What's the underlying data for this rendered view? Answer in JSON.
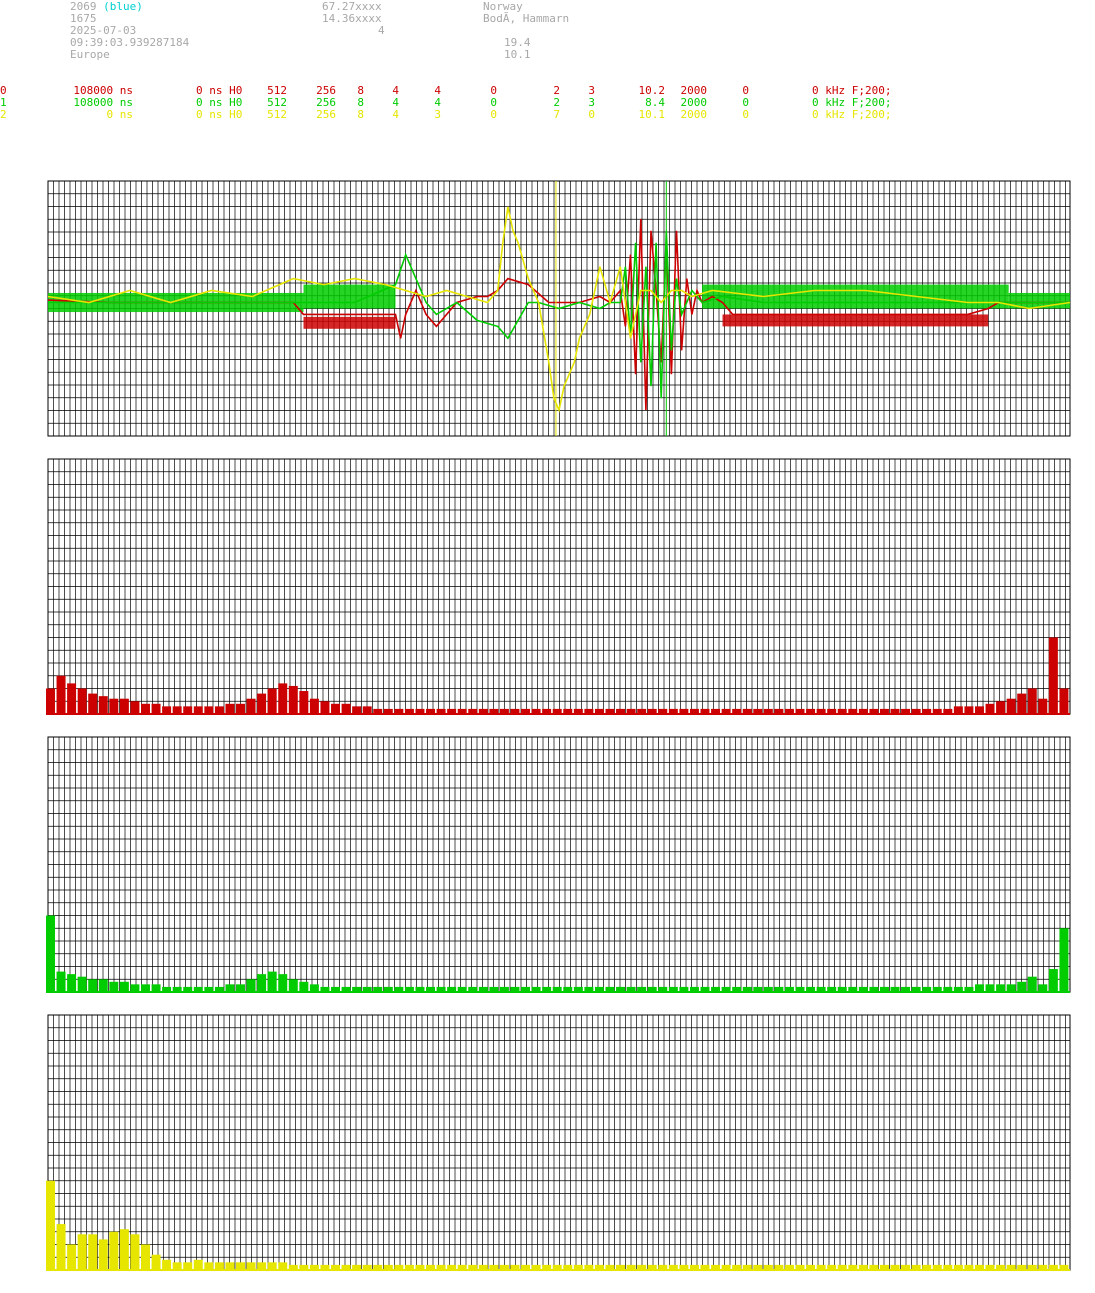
{
  "station": {
    "id": "2069",
    "id_tag": "(blue)",
    "number": "1675",
    "date": "2025-07-03",
    "time": "09:39:03.939287184",
    "region": "Europe",
    "lat": "67.27xxxx",
    "lon": "14.36xxxx",
    "count": "4",
    "country": "Norway",
    "place": "BodÃ, Hammarn",
    "val1": "19.4",
    "val2": "10.1"
  },
  "channels": [
    {
      "idx": "0",
      "c1": "108000 ns",
      "c2": "0 ns H0",
      "c3": "512",
      "c4": "256",
      "c5": "8",
      "c6": "4",
      "c7": "4",
      "c8": "0",
      "c9": "2",
      "c10": "3",
      "c11": "10.2",
      "c12": "2000",
      "c13": "0",
      "c14": "0 kHz F;200;",
      "color": "#cc0000"
    },
    {
      "idx": "1",
      "c1": "108000 ns",
      "c2": "0 ns H0",
      "c3": "512",
      "c4": "256",
      "c5": "8",
      "c6": "4",
      "c7": "4",
      "c8": "0",
      "c9": "2",
      "c10": "3",
      "c11": "8.4",
      "c12": "2000",
      "c13": "0",
      "c14": "0 kHz F;200;",
      "color": "#00cc00"
    },
    {
      "idx": "2",
      "c1": "0 ns",
      "c2": "0 ns H0",
      "c3": "512",
      "c4": "256",
      "c5": "8",
      "c6": "4",
      "c7": "3",
      "c8": "0",
      "c9": "7",
      "c10": "0",
      "c11": "10.1",
      "c12": "2000",
      "c13": "0",
      "c14": "0 kHz F;200;",
      "color": "#e6e600"
    }
  ],
  "chart_data": [
    {
      "type": "line",
      "title": "",
      "grid": true,
      "ylim": [
        -1,
        1
      ],
      "markers": [
        {
          "name": "marker-yellow",
          "x": 0.497,
          "color": "#e6e600"
        },
        {
          "name": "marker-green",
          "x": 0.605,
          "color": "#00cc00"
        }
      ],
      "series": [
        {
          "color": "#cc0000",
          "x": [
            0,
            0.06,
            0.12,
            0.18,
            0.24,
            0.25,
            0.3,
            0.34,
            0.345,
            0.35,
            0.36,
            0.37,
            0.38,
            0.4,
            0.42,
            0.43,
            0.44,
            0.45,
            0.47,
            0.49,
            0.5,
            0.52,
            0.54,
            0.55,
            0.56,
            0.565,
            0.57,
            0.575,
            0.58,
            0.585,
            0.59,
            0.595,
            0.6,
            0.605,
            0.61,
            0.615,
            0.62,
            0.625,
            0.63,
            0.635,
            0.64,
            0.65,
            0.66,
            0.67,
            0.68,
            0.7,
            0.75,
            0.8,
            0.85,
            0.9,
            0.92,
            0.93,
            1
          ],
          "y": [
            0.02,
            0.0,
            0.0,
            0.0,
            0.0,
            -0.1,
            -0.1,
            -0.1,
            -0.3,
            -0.1,
            0.1,
            -0.1,
            -0.2,
            0.0,
            0.05,
            0.05,
            0.1,
            0.2,
            0.15,
            0.0,
            0.0,
            0.0,
            0.05,
            0.0,
            0.1,
            -0.2,
            0.4,
            -0.6,
            0.7,
            -0.9,
            0.6,
            0.1,
            -0.5,
            0.5,
            -0.6,
            0.6,
            -0.4,
            0.2,
            -0.1,
            0.1,
            0.0,
            0.05,
            0.0,
            -0.1,
            -0.1,
            -0.1,
            -0.1,
            -0.1,
            -0.1,
            -0.1,
            -0.05,
            0.0,
            0.0
          ]
        },
        {
          "color": "#00cc00",
          "x": [
            0,
            0.12,
            0.24,
            0.3,
            0.34,
            0.35,
            0.36,
            0.37,
            0.38,
            0.4,
            0.42,
            0.44,
            0.45,
            0.46,
            0.47,
            0.48,
            0.5,
            0.52,
            0.54,
            0.55,
            0.56,
            0.565,
            0.57,
            0.575,
            0.58,
            0.585,
            0.59,
            0.595,
            0.6,
            0.605,
            0.61,
            0.615,
            0.62,
            0.63,
            0.64,
            0.66,
            0.7,
            0.8,
            0.9,
            0.93,
            1
          ],
          "y": [
            0.0,
            0.0,
            0.0,
            0.0,
            0.15,
            0.4,
            0.2,
            0.0,
            -0.1,
            0.0,
            -0.15,
            -0.2,
            -0.3,
            -0.15,
            0.0,
            0.0,
            -0.05,
            0.0,
            -0.05,
            0.0,
            0.0,
            0.3,
            -0.3,
            0.5,
            -0.5,
            0.3,
            -0.7,
            0.5,
            -0.8,
            0.6,
            -0.4,
            0.2,
            -0.1,
            0.1,
            0.0,
            0.05,
            0.0,
            0.0,
            0.0,
            0.0,
            0.0
          ]
        },
        {
          "color": "#e6e600",
          "x": [
            0,
            0.04,
            0.08,
            0.12,
            0.16,
            0.2,
            0.24,
            0.27,
            0.3,
            0.33,
            0.35,
            0.37,
            0.39,
            0.41,
            0.43,
            0.44,
            0.445,
            0.45,
            0.455,
            0.46,
            0.47,
            0.48,
            0.49,
            0.495,
            0.5,
            0.505,
            0.51,
            0.515,
            0.52,
            0.53,
            0.54,
            0.55,
            0.56,
            0.57,
            0.58,
            0.59,
            0.6,
            0.61,
            0.62,
            0.63,
            0.65,
            0.7,
            0.75,
            0.8,
            0.85,
            0.9,
            0.93,
            0.96,
            1
          ],
          "y": [
            0.05,
            0.0,
            0.1,
            0.0,
            0.1,
            0.05,
            0.2,
            0.15,
            0.2,
            0.15,
            0.1,
            0.05,
            0.1,
            0.05,
            0.0,
            0.1,
            0.5,
            0.8,
            0.6,
            0.5,
            0.2,
            0.0,
            -0.5,
            -0.8,
            -0.9,
            -0.7,
            -0.6,
            -0.5,
            -0.3,
            -0.1,
            0.3,
            0.0,
            0.3,
            -0.3,
            0.1,
            0.1,
            0.0,
            0.1,
            0.1,
            0.05,
            0.1,
            0.05,
            0.1,
            0.1,
            0.05,
            0.0,
            0.0,
            -0.05,
            0.0
          ]
        }
      ]
    },
    {
      "type": "bar",
      "color": "#cc0000",
      "ylim": [
        0,
        1
      ],
      "values": [
        0.1,
        0.15,
        0.12,
        0.1,
        0.08,
        0.07,
        0.06,
        0.06,
        0.05,
        0.04,
        0.04,
        0.03,
        0.03,
        0.03,
        0.03,
        0.03,
        0.03,
        0.04,
        0.04,
        0.06,
        0.08,
        0.1,
        0.12,
        0.11,
        0.09,
        0.06,
        0.05,
        0.04,
        0.04,
        0.03,
        0.03,
        0.02,
        0.02,
        0.02,
        0.02,
        0.02,
        0.02,
        0.02,
        0.02,
        0.02,
        0.02,
        0.02,
        0.02,
        0.02,
        0.02,
        0.02,
        0.02,
        0.02,
        0.02,
        0.02,
        0.02,
        0.02,
        0.02,
        0.02,
        0.02,
        0.02,
        0.02,
        0.02,
        0.02,
        0.02,
        0.02,
        0.02,
        0.02,
        0.02,
        0.02,
        0.02,
        0.02,
        0.02,
        0.02,
        0.02,
        0.02,
        0.02,
        0.02,
        0.02,
        0.02,
        0.02,
        0.02,
        0.02,
        0.02,
        0.02,
        0.02,
        0.02,
        0.02,
        0.02,
        0.02,
        0.02,
        0.03,
        0.03,
        0.03,
        0.04,
        0.05,
        0.06,
        0.08,
        0.1,
        0.06,
        0.3,
        0.1
      ]
    },
    {
      "type": "bar",
      "color": "#00cc00",
      "ylim": [
        0,
        1
      ],
      "values": [
        0.3,
        0.08,
        0.07,
        0.06,
        0.05,
        0.05,
        0.04,
        0.04,
        0.03,
        0.03,
        0.03,
        0.02,
        0.02,
        0.02,
        0.02,
        0.02,
        0.02,
        0.03,
        0.03,
        0.05,
        0.07,
        0.08,
        0.07,
        0.05,
        0.04,
        0.03,
        0.02,
        0.02,
        0.02,
        0.02,
        0.02,
        0.02,
        0.02,
        0.02,
        0.02,
        0.02,
        0.02,
        0.02,
        0.02,
        0.02,
        0.02,
        0.02,
        0.02,
        0.02,
        0.02,
        0.02,
        0.02,
        0.02,
        0.02,
        0.02,
        0.02,
        0.02,
        0.02,
        0.02,
        0.02,
        0.02,
        0.02,
        0.02,
        0.02,
        0.02,
        0.02,
        0.02,
        0.02,
        0.02,
        0.02,
        0.02,
        0.02,
        0.02,
        0.02,
        0.02,
        0.02,
        0.02,
        0.02,
        0.02,
        0.02,
        0.02,
        0.02,
        0.02,
        0.02,
        0.02,
        0.02,
        0.02,
        0.02,
        0.02,
        0.02,
        0.02,
        0.02,
        0.02,
        0.03,
        0.03,
        0.03,
        0.03,
        0.04,
        0.06,
        0.03,
        0.09,
        0.25
      ]
    },
    {
      "type": "bar",
      "color": "#e6e600",
      "ylim": [
        0,
        1
      ],
      "values": [
        0.35,
        0.18,
        0.1,
        0.14,
        0.14,
        0.12,
        0.15,
        0.16,
        0.14,
        0.1,
        0.06,
        0.04,
        0.03,
        0.03,
        0.04,
        0.03,
        0.03,
        0.03,
        0.03,
        0.03,
        0.03,
        0.03,
        0.03,
        0.02,
        0.02,
        0.02,
        0.02,
        0.02,
        0.02,
        0.02,
        0.02,
        0.02,
        0.02,
        0.02,
        0.02,
        0.02,
        0.02,
        0.02,
        0.02,
        0.02,
        0.02,
        0.02,
        0.02,
        0.02,
        0.02,
        0.02,
        0.02,
        0.02,
        0.02,
        0.02,
        0.02,
        0.02,
        0.02,
        0.02,
        0.02,
        0.02,
        0.02,
        0.02,
        0.02,
        0.02,
        0.02,
        0.02,
        0.02,
        0.02,
        0.02,
        0.02,
        0.02,
        0.02,
        0.02,
        0.02,
        0.02,
        0.02,
        0.02,
        0.02,
        0.02,
        0.02,
        0.02,
        0.02,
        0.02,
        0.02,
        0.02,
        0.02,
        0.02,
        0.02,
        0.02,
        0.02,
        0.02,
        0.02,
        0.02,
        0.02,
        0.02,
        0.02,
        0.02,
        0.02,
        0.02,
        0.02,
        0.02
      ]
    }
  ]
}
